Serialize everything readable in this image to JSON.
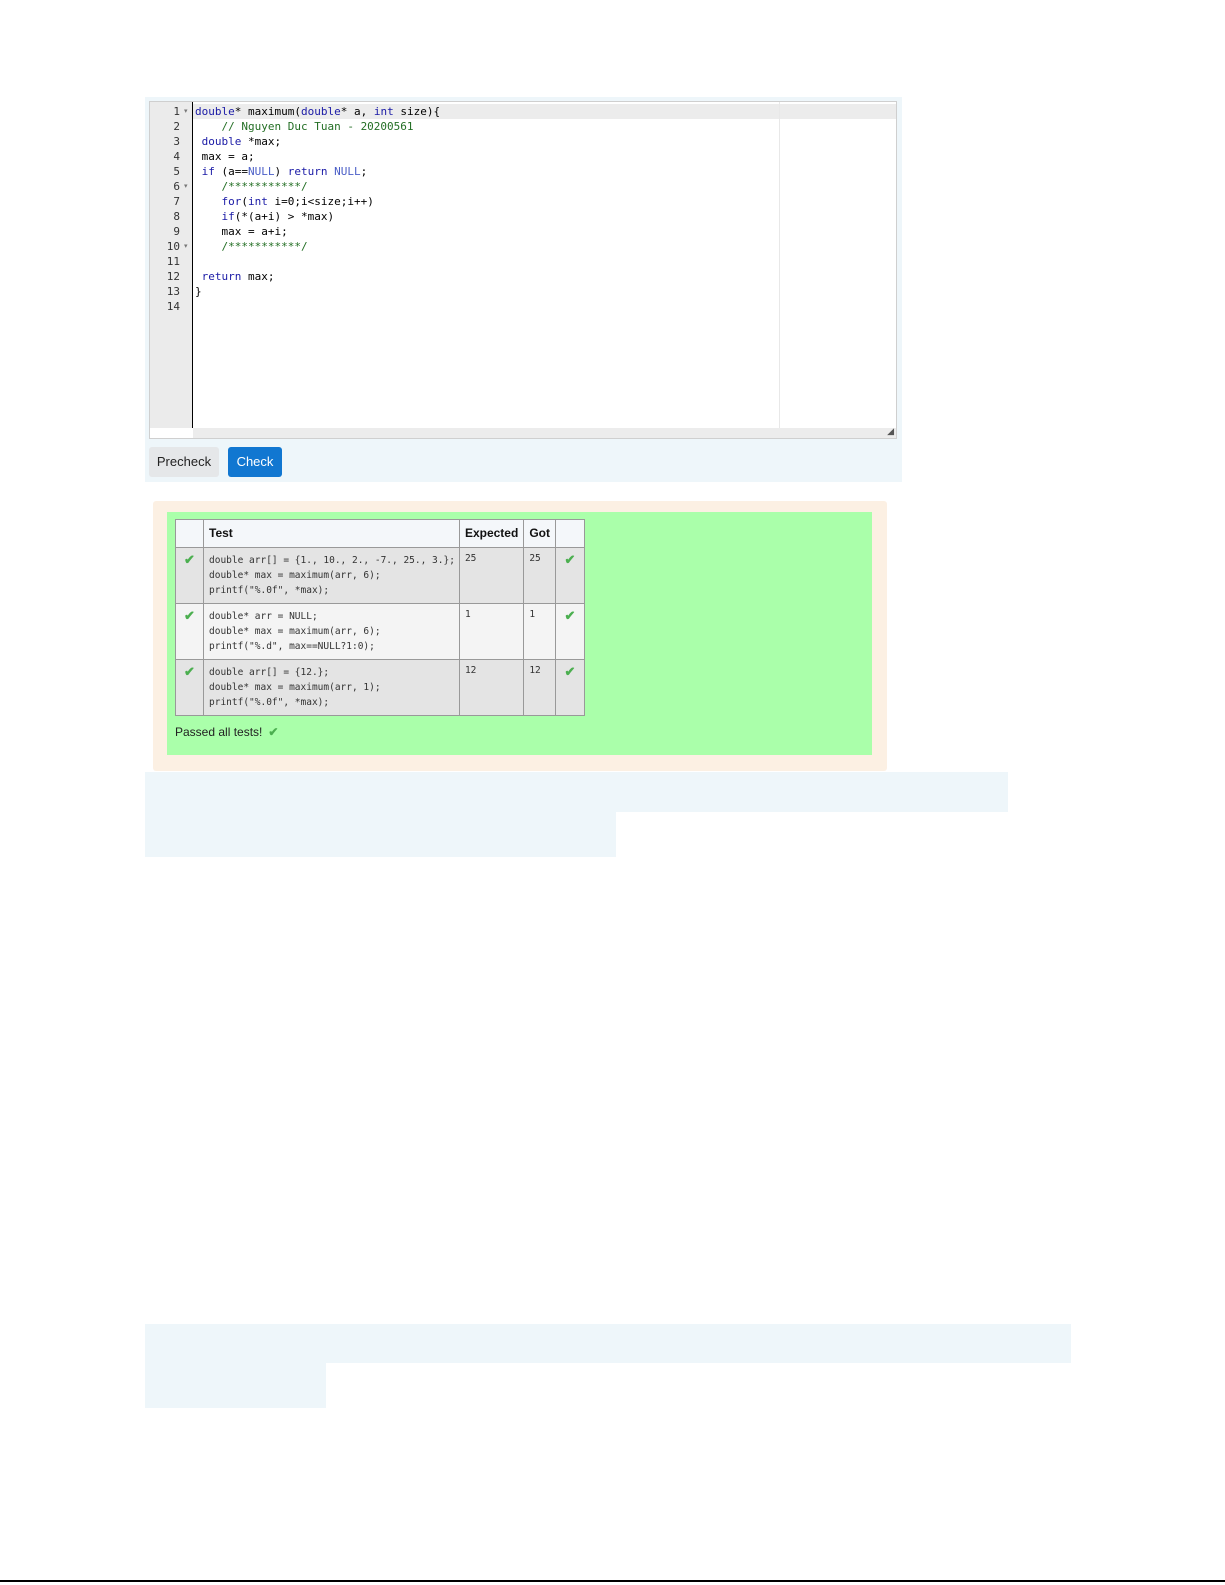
{
  "editor": {
    "line_numbers": [
      "1",
      "2",
      "3",
      "4",
      "5",
      "6",
      "7",
      "8",
      "9",
      "10",
      "11",
      "12",
      "13",
      "14"
    ],
    "fold_markers": [
      {
        "line": 1,
        "glyph": "▾"
      },
      {
        "line": 6,
        "glyph": "▾"
      },
      {
        "line": 10,
        "glyph": "▾"
      }
    ],
    "lines": [
      [
        {
          "t": "double",
          "c": "#1a1aa6"
        },
        {
          "t": "* maximum(",
          "c": "#000000"
        },
        {
          "t": "double",
          "c": "#1a1aa6"
        },
        {
          "t": "* a, ",
          "c": "#000000"
        },
        {
          "t": "int",
          "c": "#1a1aa6"
        },
        {
          "t": " size){",
          "c": "#000000"
        }
      ],
      [
        {
          "t": "    // Nguyen Duc Tuan - 20200561",
          "c": "#236e24"
        }
      ],
      [
        {
          "t": " double",
          "c": "#1a1aa6"
        },
        {
          "t": " *max;",
          "c": "#000000"
        }
      ],
      [
        {
          "t": " max = a;",
          "c": "#000000"
        }
      ],
      [
        {
          "t": " if",
          "c": "#1a1aa6"
        },
        {
          "t": " (a==",
          "c": "#000000"
        },
        {
          "t": "NULL",
          "c": "#4a5ec7"
        },
        {
          "t": ") ",
          "c": "#000000"
        },
        {
          "t": "return",
          "c": "#1a1aa6"
        },
        {
          "t": " ",
          "c": "#000000"
        },
        {
          "t": "NULL",
          "c": "#4a5ec7"
        },
        {
          "t": ";",
          "c": "#000000"
        }
      ],
      [
        {
          "t": "    /***********/",
          "c": "#236e24"
        }
      ],
      [
        {
          "t": "    for",
          "c": "#1a1aa6"
        },
        {
          "t": "(",
          "c": "#000000"
        },
        {
          "t": "int",
          "c": "#1a1aa6"
        },
        {
          "t": " i=0;i<size;i++)",
          "c": "#000000"
        }
      ],
      [
        {
          "t": "    if",
          "c": "#1a1aa6"
        },
        {
          "t": "(*(a+i) > *max)",
          "c": "#000000"
        }
      ],
      [
        {
          "t": "    max = a+i;",
          "c": "#000000"
        }
      ],
      [
        {
          "t": "    /***********/",
          "c": "#236e24"
        }
      ],
      [
        {
          "t": "",
          "c": "#000000"
        }
      ],
      [
        {
          "t": " return",
          "c": "#1a1aa6"
        },
        {
          "t": " max;",
          "c": "#000000"
        }
      ],
      [
        {
          "t": "}",
          "c": "#000000"
        }
      ],
      [
        {
          "t": "",
          "c": "#000000"
        }
      ]
    ]
  },
  "buttons": {
    "precheck_label": "Precheck",
    "check_label": "Check"
  },
  "results": {
    "headers": [
      "",
      "Test",
      "Expected",
      "Got",
      ""
    ],
    "rows": [
      {
        "test_lines": [
          "double arr[] = {1., 10., 2., -7., 25., 3.};",
          "double* max = maximum(arr, 6);",
          "printf(\"%.0f\", *max);"
        ],
        "expected": "25",
        "got": "25"
      },
      {
        "test_lines": [
          "double* arr = NULL;",
          "double* max = maximum(arr, 6);",
          "printf(\"%.d\", max==NULL?1:0);"
        ],
        "expected": "1",
        "got": "1"
      },
      {
        "test_lines": [
          "double arr[] = {12.};",
          "double* max = maximum(arr, 1);",
          "printf(\"%.0f\", *max);"
        ],
        "expected": "12",
        "got": "12"
      }
    ],
    "summary": "Passed all tests!"
  },
  "colors": {
    "pass_green": "#4caf50",
    "result_background": "#aaffaa",
    "check_button": "#1177d1"
  },
  "icons": {
    "pass": "✔",
    "resize": "◢"
  }
}
